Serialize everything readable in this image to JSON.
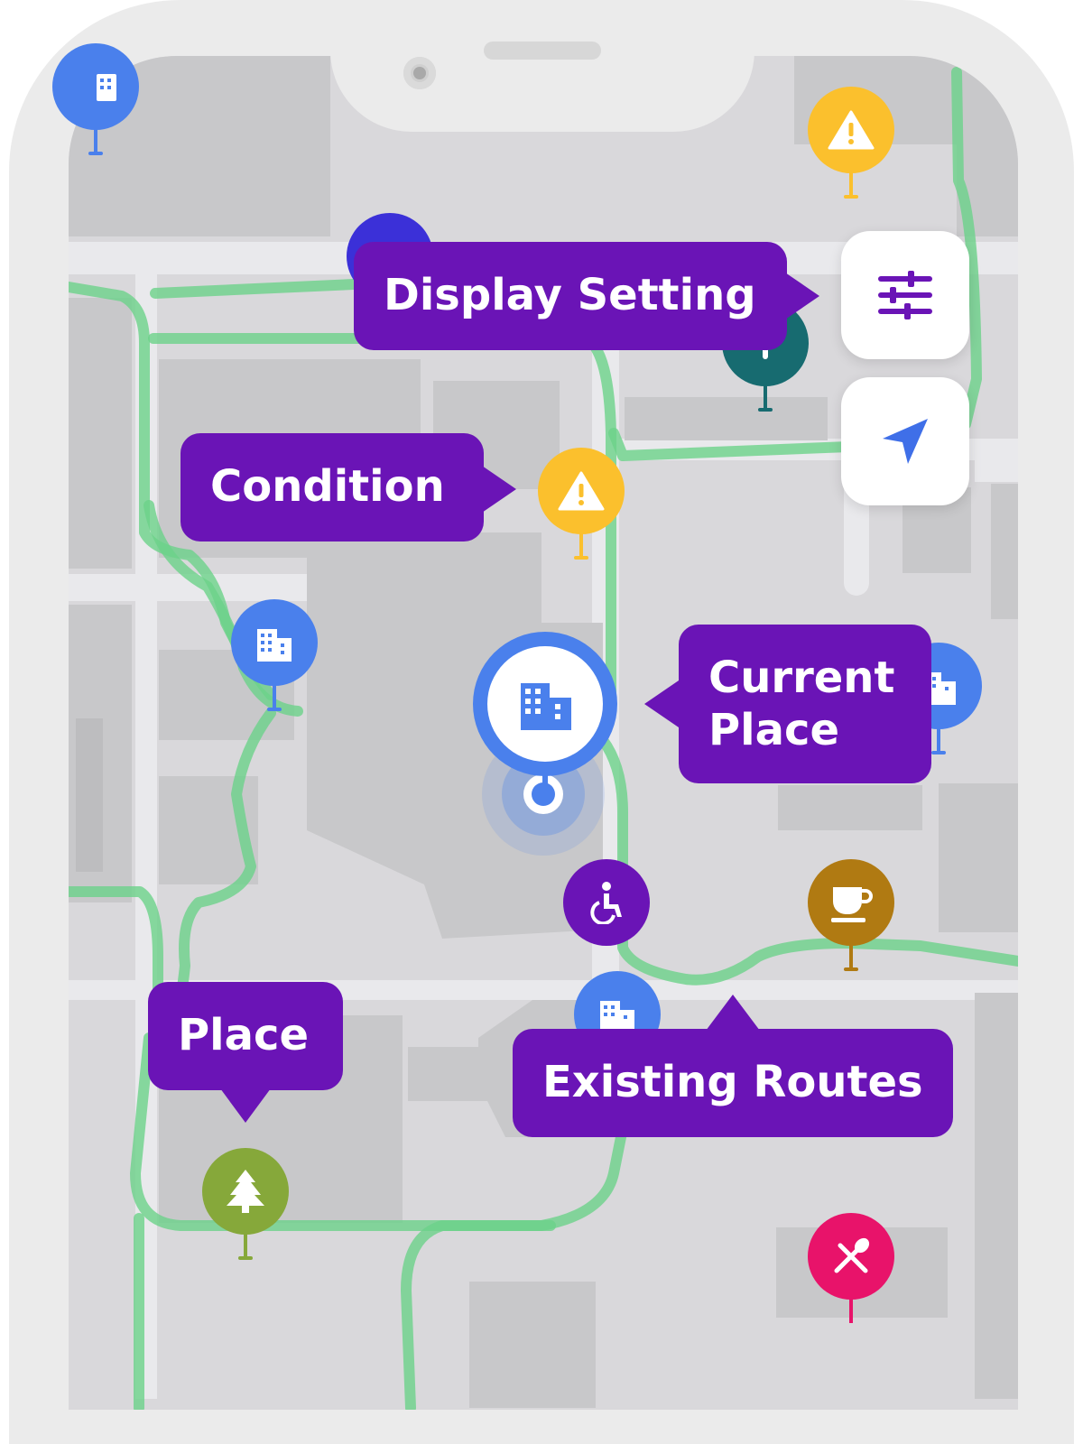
{
  "callouts": {
    "display_setting": "Display Setting",
    "condition": "Condition",
    "current_place_line1": "Current",
    "current_place_line2": "Place",
    "place": "Place",
    "existing_routes": "Existing Routes"
  },
  "controls": {
    "display_setting_icon": "sliders-icon",
    "navigate_icon": "navigation-arrow-icon"
  },
  "markers": [
    {
      "type": "building",
      "icon": "building-icon",
      "color": "#4a80ec"
    },
    {
      "type": "warning",
      "icon": "warning-icon",
      "color": "#fbc02d"
    },
    {
      "type": "parking",
      "icon": "parking-icon",
      "color": "#3b30d8"
    },
    {
      "type": "info",
      "icon": "info-icon",
      "color": "#176b70"
    },
    {
      "type": "accessible",
      "icon": "wheelchair-icon",
      "color": "#6a14b6"
    },
    {
      "type": "cafe",
      "icon": "coffee-cup-icon",
      "color": "#b07a12"
    },
    {
      "type": "park",
      "icon": "tree-icon",
      "color": "#86a83a"
    },
    {
      "type": "restaurant",
      "icon": "fork-knife-icon",
      "color": "#e8136a"
    }
  ],
  "colors": {
    "callout": "#6a14b6",
    "route": "#6bd28a",
    "map_background": "#d9d8db",
    "building_fill": "#c8c8ca",
    "road": "#e9e9ec",
    "current_place": "#4a80ec"
  }
}
